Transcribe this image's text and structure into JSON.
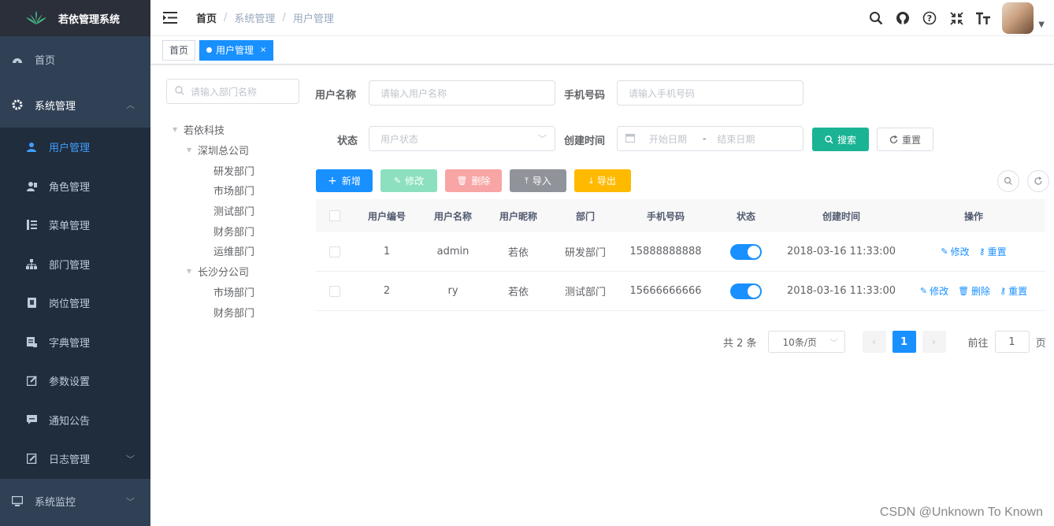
{
  "app": {
    "title": "若依管理系统"
  },
  "sidebar": {
    "home": "首页",
    "system": "系统管理",
    "sub_items": [
      {
        "label": "用户管理",
        "icon": "user-icon"
      },
      {
        "label": "角色管理",
        "icon": "role-icon"
      },
      {
        "label": "菜单管理",
        "icon": "menu-tree-icon"
      },
      {
        "label": "部门管理",
        "icon": "org-icon"
      },
      {
        "label": "岗位管理",
        "icon": "post-icon"
      },
      {
        "label": "字典管理",
        "icon": "dict-icon"
      },
      {
        "label": "参数设置",
        "icon": "edit-icon"
      },
      {
        "label": "通知公告",
        "icon": "message-icon"
      },
      {
        "label": "日志管理",
        "icon": "log-icon"
      }
    ],
    "monitor": "系统监控"
  },
  "breadcrumb": [
    "首页",
    "系统管理",
    "用户管理"
  ],
  "tags": {
    "home": "首页",
    "active": "用户管理"
  },
  "dept": {
    "search_placeholder": "请输入部门名称",
    "tree": [
      {
        "label": "若依科技",
        "level": 1,
        "expanded": true
      },
      {
        "label": "深圳总公司",
        "level": 2,
        "expanded": true
      },
      {
        "label": "研发部门",
        "level": 3
      },
      {
        "label": "市场部门",
        "level": 3
      },
      {
        "label": "测试部门",
        "level": 3
      },
      {
        "label": "财务部门",
        "level": 3
      },
      {
        "label": "运维部门",
        "level": 3
      },
      {
        "label": "长沙分公司",
        "level": 2,
        "expanded": true
      },
      {
        "label": "市场部门",
        "level": 3
      },
      {
        "label": "财务部门",
        "level": 3
      }
    ]
  },
  "form": {
    "username_label": "用户名称",
    "username_placeholder": "请输入用户名称",
    "phone_label": "手机号码",
    "phone_placeholder": "请输入手机号码",
    "status_label": "状态",
    "status_placeholder": "用户状态",
    "time_label": "创建时间",
    "start_placeholder": "开始日期",
    "range_sep": "-",
    "end_placeholder": "结束日期",
    "search_btn": "搜索",
    "reset_btn": "重置"
  },
  "toolbar": {
    "add": "新增",
    "edit": "修改",
    "delete": "删除",
    "import": "导入",
    "export": "导出"
  },
  "table": {
    "headers": [
      "用户编号",
      "用户名称",
      "用户昵称",
      "部门",
      "手机号码",
      "状态",
      "创建时间",
      "操作"
    ],
    "rows": [
      {
        "id": "1",
        "name": "admin",
        "nick": "若依",
        "dept": "研发部门",
        "phone": "15888888888",
        "enabled": true,
        "time": "2018-03-16 11:33:00",
        "ops": [
          "修改",
          "重置"
        ]
      },
      {
        "id": "2",
        "name": "ry",
        "nick": "若依",
        "dept": "测试部门",
        "phone": "15666666666",
        "enabled": true,
        "time": "2018-03-16 11:33:00",
        "ops": [
          "修改",
          "删除",
          "重置"
        ]
      }
    ]
  },
  "pagination": {
    "total": "共 2 条",
    "page_size": "10条/页",
    "current": "1",
    "goto_label": "前往",
    "goto_value": "1",
    "page_suffix": "页"
  },
  "watermark": "CSDN @Unknown To Known",
  "colors": {
    "sidebar": "#304156",
    "primary": "#1890ff",
    "teal": "#1ab394"
  }
}
